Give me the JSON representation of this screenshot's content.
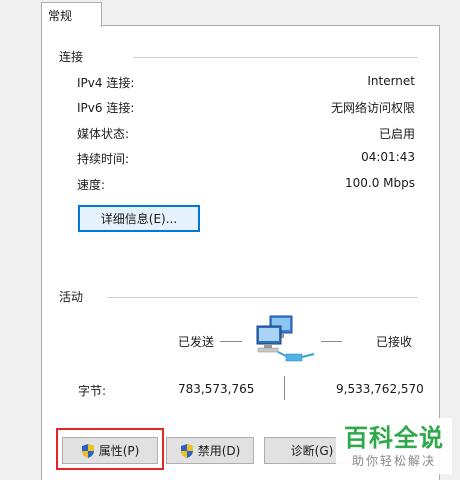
{
  "tab": {
    "label": "常规"
  },
  "connection": {
    "heading": "连接",
    "rows": [
      {
        "label": "IPv4 连接:",
        "value": "Internet"
      },
      {
        "label": "IPv6 连接:",
        "value": "无网络访问权限"
      },
      {
        "label": "媒体状态:",
        "value": "已启用"
      },
      {
        "label": "持续时间:",
        "value": "04:01:43"
      },
      {
        "label": "速度:",
        "value": "100.0 Mbps"
      }
    ],
    "details_button": "详细信息(E)..."
  },
  "activity": {
    "heading": "活动",
    "sent_label": "已发送",
    "received_label": "已接收",
    "bytes_label": "字节:",
    "bytes_sent": "783,573,765",
    "bytes_received": "9,533,762,570",
    "icon": "network-computers-icon"
  },
  "actions": {
    "properties": "属性(P)",
    "disable": "禁用(D)",
    "diagnose": "诊断(G)"
  },
  "watermark": {
    "logo": "百科全说",
    "sub": "助你轻松解决"
  },
  "colors": {
    "focus_border": "#0078d7",
    "highlight": "#e4242b",
    "watermark_green": "#2fa84a"
  }
}
